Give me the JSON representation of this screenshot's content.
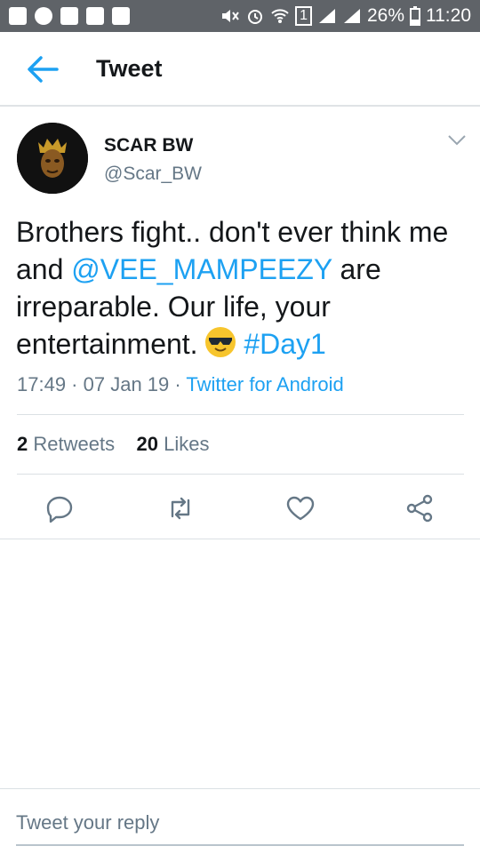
{
  "status_bar": {
    "battery": "26%",
    "time": "11:20",
    "sim_label": "1"
  },
  "app_bar": {
    "title": "Tweet"
  },
  "tweet": {
    "author_name": "SCAR BW",
    "author_handle": "@Scar_BW",
    "text_part1": "Brothers fight.. don't ever think me and ",
    "mention": "@VEE_MAMPEEZY",
    "text_part2": " are irreparable. Our life, your entertainment. ",
    "emoji": "smiling-face-with-sunglasses",
    "hashtag": "#Day1",
    "time": "17:49",
    "date": "07 Jan 19",
    "separator": " · ",
    "source": "Twitter for Android",
    "retweets_count": "2",
    "retweets_label": "Retweets",
    "likes_count": "20",
    "likes_label": "Likes"
  },
  "actions": [
    {
      "icon": "reply-icon"
    },
    {
      "icon": "retweet-icon"
    },
    {
      "icon": "like-icon"
    },
    {
      "icon": "share-icon"
    }
  ],
  "reply_box": {
    "placeholder": "Tweet your reply"
  },
  "colors": {
    "accent": "#1da1f2",
    "secondary_text": "#657786",
    "status_bar": "#5f6368"
  }
}
